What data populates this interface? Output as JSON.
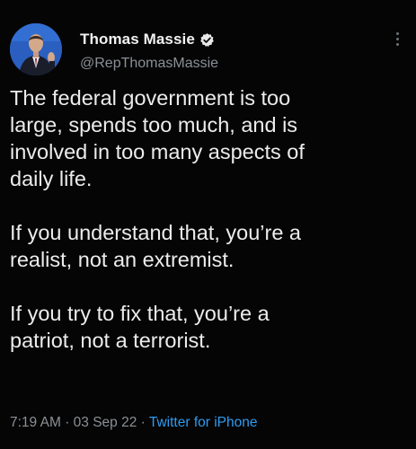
{
  "tweet": {
    "author": {
      "display_name": "Thomas Massie",
      "handle": "@RepThomasMassie",
      "verified": true,
      "avatar_icon": "profile-photo"
    },
    "more_icon": "vertical-ellipsis-icon",
    "paragraphs": [
      "The federal government is too\nlarge, spends too much, and is\ninvolved in too many aspects of\ndaily life.",
      "If you understand that, you’re a\nrealist, not an extremist.",
      "If you try to fix that, you’re a\npatriot, not a terrorist."
    ],
    "timestamp": "7:19 AM",
    "separator": "·",
    "date": "03 Sep 22",
    "source": "Twitter for iPhone"
  },
  "colors": {
    "background": "#050505",
    "text": "#ececec",
    "secondary": "#8b9096",
    "link": "#2f9bf0",
    "verified": "#1d9bf0"
  }
}
